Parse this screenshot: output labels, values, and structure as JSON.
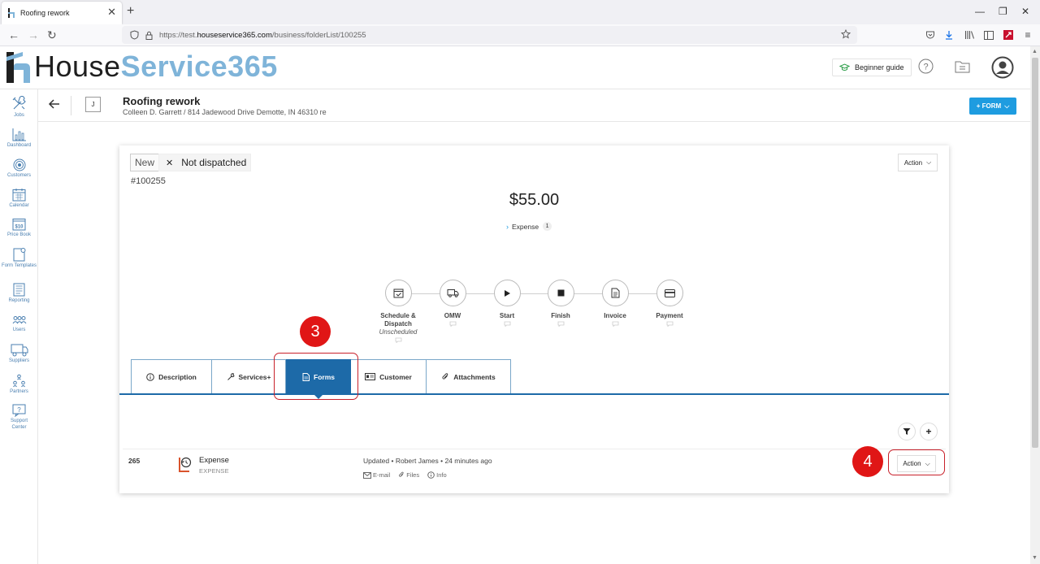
{
  "browser": {
    "tab_title": "Roofing rework",
    "url_prefix": "https://test.",
    "url_host": "houseservice365.com",
    "url_path": "/business/folderList/100255"
  },
  "header": {
    "logo_part1": "House",
    "logo_part2": "Service365",
    "beginner_guide": "Beginner guide"
  },
  "sidebar": {
    "items": [
      {
        "label": "Jobs",
        "icon": "tools-icon"
      },
      {
        "label": "Dashboard",
        "icon": "bar-chart-icon"
      },
      {
        "label": "Customers",
        "icon": "target-icon"
      },
      {
        "label": "Calendar",
        "icon": "calendar-icon"
      },
      {
        "label": "Price Book",
        "icon": "price-tag-icon"
      },
      {
        "label": "Form Templates",
        "icon": "form-templates-icon"
      },
      {
        "label": "Reporting",
        "icon": "report-icon"
      },
      {
        "label": "Users",
        "icon": "users-icon"
      },
      {
        "label": "Suppliers",
        "icon": "truck-icon"
      },
      {
        "label": "Partners",
        "icon": "partners-icon"
      },
      {
        "label": "Support Center",
        "icon": "help-icon"
      }
    ]
  },
  "job": {
    "initial": "J",
    "title": "Roofing rework",
    "subtitle": "Colleen D. Garrett / 814 Jadewood Drive Demotte, IN 46310 re",
    "form_button": "+ FORM",
    "status_new": "New",
    "status_dispatch": "Not dispatched",
    "number": "#100255",
    "action_label": "Action",
    "price": "$55.00",
    "expense_label": "Expense",
    "expense_count": "1"
  },
  "workflow": [
    {
      "label": "Schedule & Dispatch",
      "sub": "Unscheduled",
      "icon": "calendar-check-icon"
    },
    {
      "label": "OMW",
      "sub": "",
      "icon": "truck-icon"
    },
    {
      "label": "Start",
      "sub": "",
      "icon": "play-icon"
    },
    {
      "label": "Finish",
      "sub": "",
      "icon": "stop-icon"
    },
    {
      "label": "Invoice",
      "sub": "",
      "icon": "document-icon"
    },
    {
      "label": "Payment",
      "sub": "",
      "icon": "credit-card-icon"
    }
  ],
  "tabs": [
    {
      "label": "Description",
      "icon": "info-icon"
    },
    {
      "label": "Services+",
      "icon": "wrench-icon"
    },
    {
      "label": "Forms",
      "icon": "form-icon",
      "active": true
    },
    {
      "label": "Customer",
      "icon": "id-card-icon"
    },
    {
      "label": "Attachments",
      "icon": "paperclip-icon"
    }
  ],
  "form_row": {
    "id": "265",
    "name": "Expense",
    "type": "EXPENSE",
    "updated": "Updated • Robert James • 24 minutes ago",
    "link_email": "E-mail",
    "link_files": "Files",
    "link_info": "Info",
    "action": "Action"
  },
  "annotations": {
    "step_3": "3",
    "step_4": "4"
  },
  "colors": {
    "primary_blue": "#1e9ce0",
    "tab_active": "#1d6aa8",
    "logo_service": "#7fb4d9",
    "annotation_red": "#e01616"
  }
}
